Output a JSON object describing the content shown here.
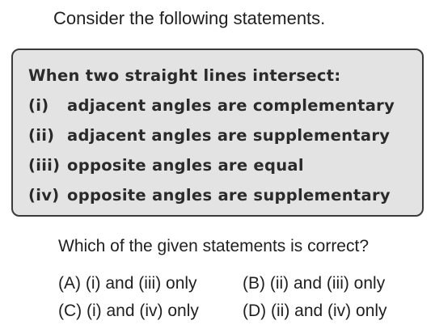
{
  "intro": "Consider the following statements.",
  "box": {
    "heading": "When two straight lines intersect:",
    "statements": [
      {
        "numeral": "(i)",
        "text": "adjacent angles are complementary"
      },
      {
        "numeral": "(ii)",
        "text": "adjacent angles are supplementary"
      },
      {
        "numeral": "(iii)",
        "text": "opposite angles are equal"
      },
      {
        "numeral": "(iv)",
        "text": "opposite angles are supplementary"
      }
    ]
  },
  "question": "Which of the given statements is correct?",
  "options": [
    {
      "label": "(A)",
      "text": "(i) and (iii) only"
    },
    {
      "label": "(B)",
      "text": "(ii) and (iii) only"
    },
    {
      "label": "(C)",
      "text": "(i) and (iv) only"
    },
    {
      "label": "(D)",
      "text": "(ii) and (iv) only"
    }
  ]
}
